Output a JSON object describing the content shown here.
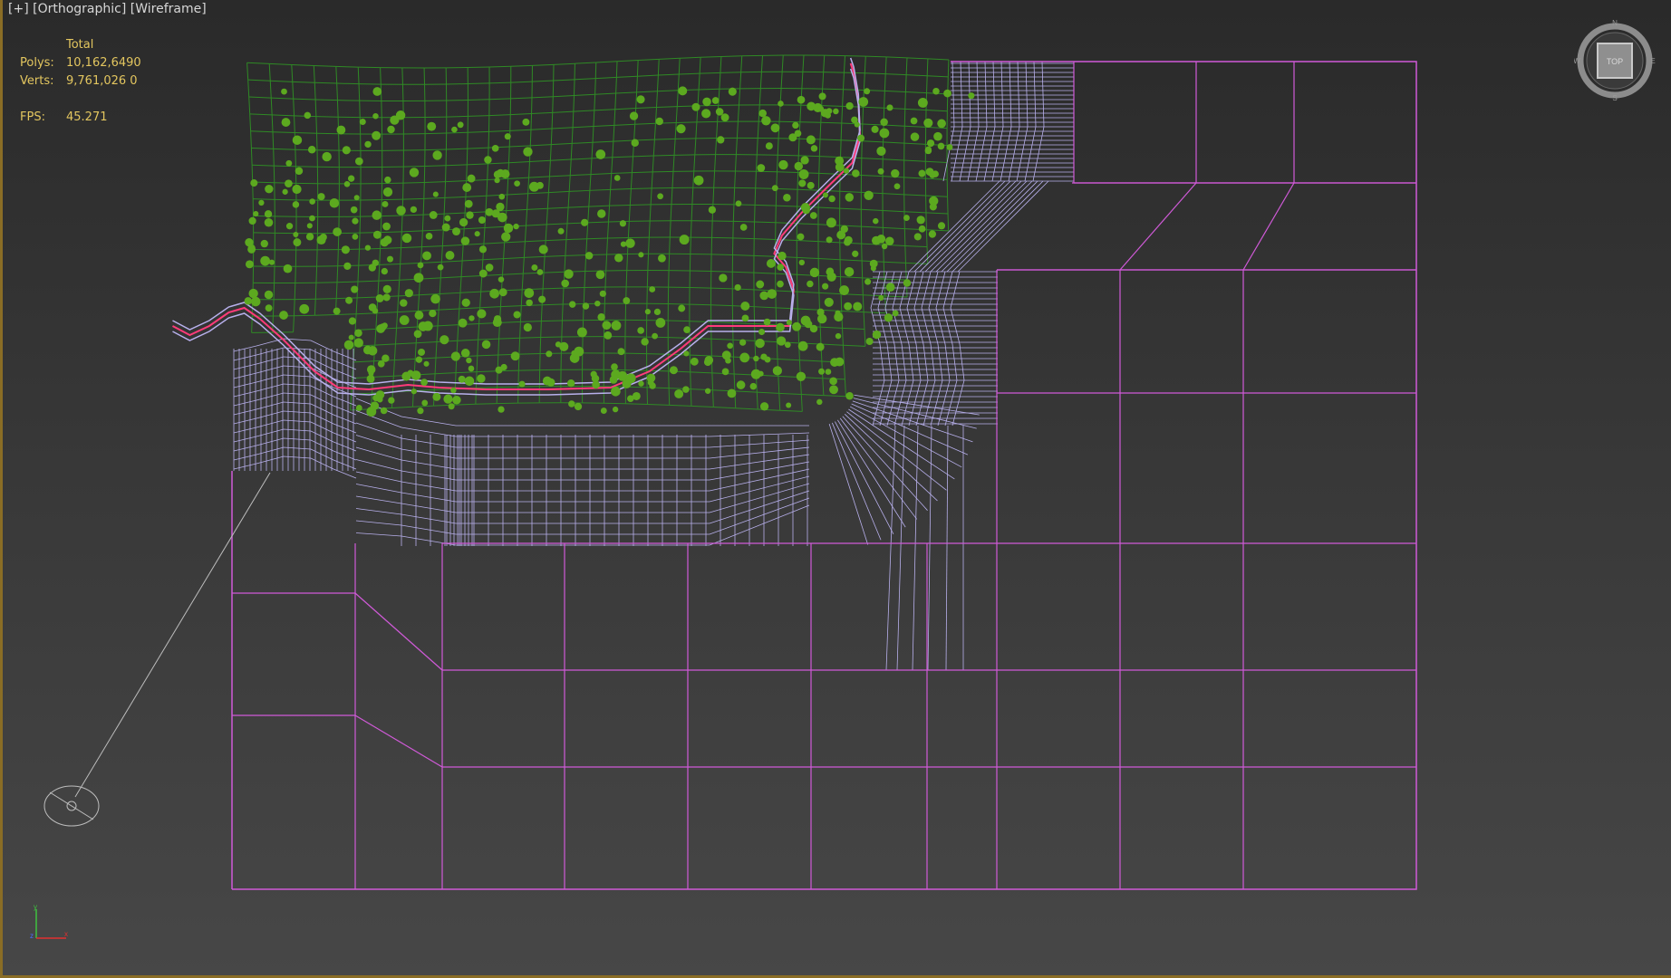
{
  "viewport": {
    "label_parts": [
      "[+]",
      "[Orthographic]",
      "[Wireframe]"
    ],
    "border_color": "#8a6d25"
  },
  "stats": {
    "header": "Total",
    "polys_label": "Polys:",
    "polys_value": "10,162,6490",
    "verts_label": "Verts:",
    "verts_value": "9,761,026 0",
    "fps_label": "FPS:",
    "fps_value": "45.271",
    "text_color": "#e3c65f"
  },
  "viewcube": {
    "face_label": "TOP",
    "compass": {
      "north": "N",
      "south": "S",
      "east": "E",
      "west": "W"
    }
  },
  "axis_gizmo": {
    "x": "x",
    "y": "y",
    "z": "z"
  },
  "colors": {
    "terrain_wire": "#2f8a25",
    "trees": "#5ca91f",
    "road_mesh": "#b8b0ec",
    "road_edge": "#ff3b7a",
    "plane_wire": "#d05ad8",
    "camera_line": "#bdbdbd"
  },
  "icons": [
    "viewcube-icon",
    "axis-gizmo-icon",
    "light-target-icon"
  ]
}
